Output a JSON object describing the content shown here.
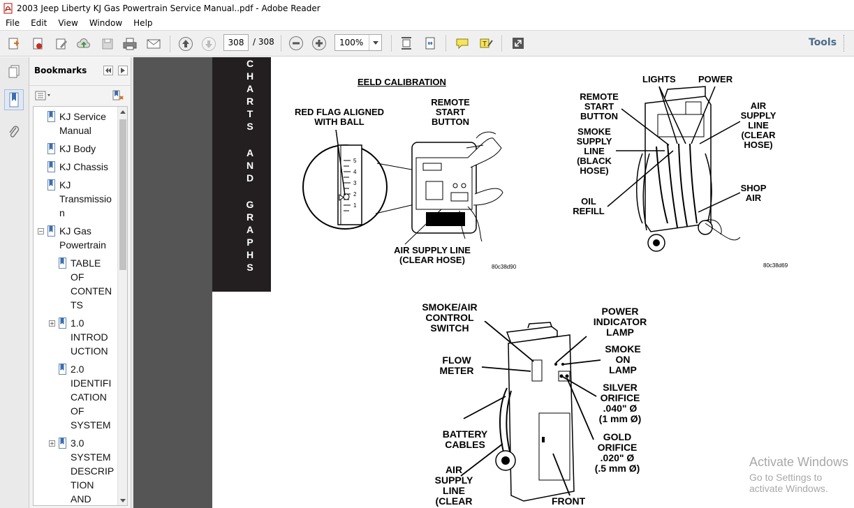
{
  "window": {
    "title": "2003 Jeep Liberty KJ Gas Powertrain Service Manual..pdf - Adobe Reader"
  },
  "menu": [
    "File",
    "Edit",
    "View",
    "Window",
    "Help"
  ],
  "toolbar": {
    "current_page": "308",
    "total_pages": "/ 308",
    "zoom": "100%",
    "tools_label": "Tools"
  },
  "bookmarks": {
    "header": "Bookmarks",
    "items": [
      {
        "lines": [
          "KJ Service",
          "Manual"
        ]
      },
      {
        "lines": [
          "KJ Body"
        ]
      },
      {
        "lines": [
          "KJ Chassis"
        ]
      },
      {
        "lines": [
          "KJ",
          "Transmissio",
          "n"
        ]
      },
      {
        "lines": [
          "KJ Gas",
          "Powertrain"
        ],
        "expander": "−"
      },
      {
        "lines": [
          "TABLE",
          "OF",
          "CONTEN",
          "TS"
        ]
      },
      {
        "lines": [
          "1.0",
          "INTROD",
          "UCTION"
        ],
        "expander": "+"
      },
      {
        "lines": [
          "2.0",
          "IDENTIFI",
          "CATION",
          "OF",
          "SYSTEM"
        ]
      },
      {
        "lines": [
          "3.0",
          "SYSTEM",
          "DESCRIP",
          "TION",
          "AND"
        ],
        "expander": "+"
      }
    ]
  },
  "document": {
    "side_tab": {
      "word1": [
        "C",
        "H",
        "A",
        "R",
        "T",
        "S"
      ],
      "word2": [
        "A",
        "N",
        "D"
      ],
      "word3": [
        "G",
        "R",
        "A",
        "P",
        "H",
        "S"
      ]
    },
    "fig1": {
      "title": "EELD CALIBRATION",
      "red_flag": [
        "RED FLAG ALIGNED",
        "WITH BALL"
      ],
      "remote": [
        "REMOTE",
        "START",
        "BUTTON"
      ],
      "air_supply": [
        "AIR SUPPLY LINE",
        "(CLEAR HOSE)"
      ],
      "code": "80c38d90",
      "scale": [
        "5",
        "4",
        "3",
        "2",
        "1"
      ]
    },
    "fig2": {
      "lights": "LIGHTS",
      "power": "POWER",
      "remote": [
        "REMOTE",
        "START",
        "BUTTON"
      ],
      "smoke": [
        "SMOKE",
        "SUPPLY",
        "LINE",
        "(BLACK",
        "HOSE)"
      ],
      "air": [
        "AIR",
        "SUPPLY",
        "LINE",
        "(CLEAR",
        "HOSE)"
      ],
      "oil": [
        "OIL",
        "REFILL"
      ],
      "shop": [
        "SHOP",
        "AIR"
      ],
      "code": "80c38d69"
    },
    "fig3": {
      "smoke_air": [
        "SMOKE/AIR",
        "CONTROL",
        "SWITCH"
      ],
      "power_lamp": [
        "POWER",
        "INDICATOR",
        "LAMP"
      ],
      "flow": [
        "FLOW",
        "METER"
      ],
      "smoke_on": [
        "SMOKE",
        "ON",
        "LAMP"
      ],
      "silver": [
        "SILVER",
        "ORIFICE",
        ".040\" Ø",
        "(1 mm Ø)"
      ],
      "battery": [
        "BATTERY",
        "CABLES"
      ],
      "gold": [
        "GOLD",
        "ORIFICE",
        ".020\" Ø",
        "(.5 mm Ø)"
      ],
      "air": [
        "AIR",
        "SUPPLY",
        "LINE",
        "(CLEAR"
      ],
      "front": "FRONT"
    }
  },
  "watermark": {
    "line1": "Activate Windows",
    "line2": "Go to Settings to activate Windows."
  },
  "colors": {
    "toolbar_bg": "#f0f0f0",
    "viewer_bg": "#555555",
    "tools_text": "#4a6b8c",
    "side_tab_bg": "#231f20"
  }
}
